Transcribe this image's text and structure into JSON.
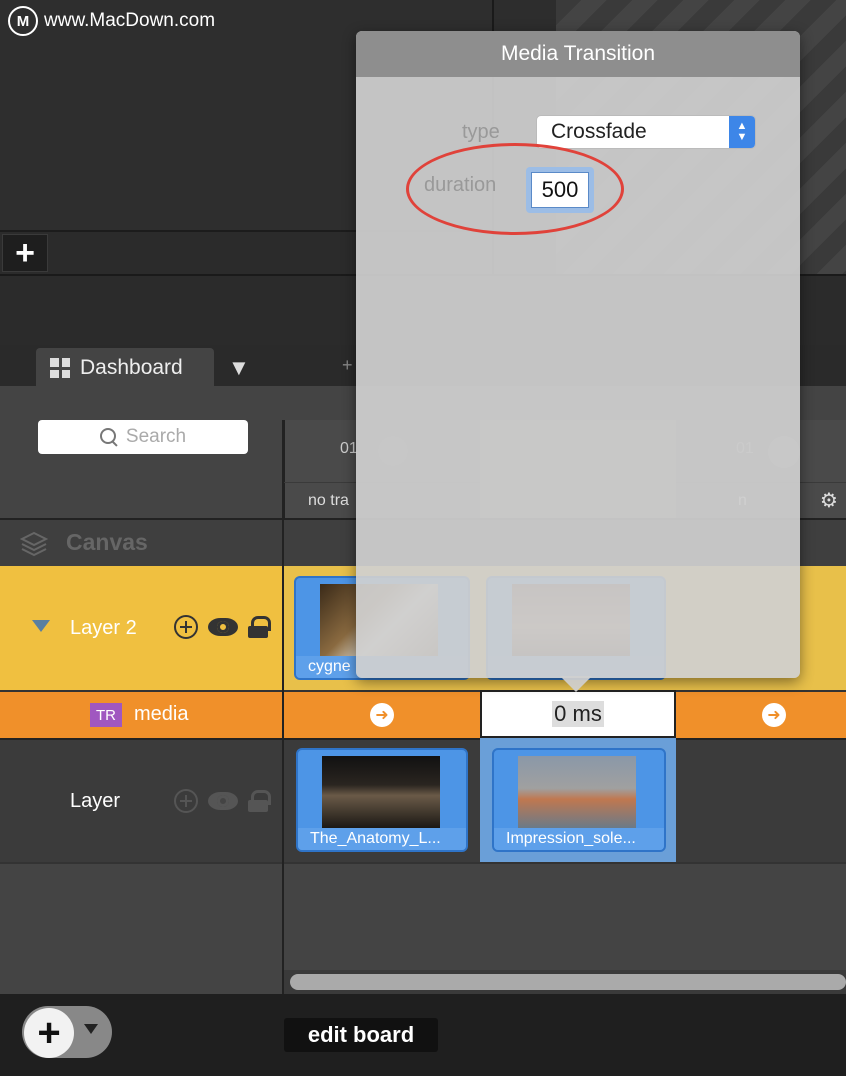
{
  "watermark": {
    "logo": "M",
    "text": "www.MacDown.com"
  },
  "top": {
    "add_output_symbol": "+"
  },
  "tabs": [
    {
      "label": "Dashboard",
      "icon": "grid-icon"
    }
  ],
  "tab_dropdown_symbol": "▼",
  "tab_add_symbol": "+",
  "search": {
    "placeholder": "Search"
  },
  "columns": [
    {
      "number": "01",
      "transition": "no tra"
    },
    {
      "number": "",
      "transition": ""
    },
    {
      "number": "01",
      "transition": "n"
    }
  ],
  "canvas": {
    "label": "Canvas",
    "icon": "layers-icon"
  },
  "layers": [
    {
      "name": "Layer 2",
      "expanded": true,
      "clips": [
        {
          "label": "cygne"
        },
        {
          "label": ""
        }
      ]
    },
    {
      "name": "Layer",
      "clips": [
        {
          "label": "The_Anatomy_L..."
        },
        {
          "label": "Impression_sole..."
        }
      ]
    }
  ],
  "media_row": {
    "badge": "TR",
    "label": "media",
    "transition_value": "0 ms",
    "go_symbol": "➜"
  },
  "gear_symbol": "⚙",
  "bottom_bar": {
    "add_layer_symbol": "+",
    "edit_board_label": "edit board"
  },
  "popover": {
    "title": "Media Transition",
    "type_label": "type",
    "type_value": "Crossfade",
    "duration_label": "duration",
    "duration_value": "500"
  },
  "colors": {
    "layer_active": "#f0c040",
    "media_row": "#f0902a",
    "clip_blue": "#4d95e6",
    "tr_badge": "#a057c0",
    "highlight_red": "#e0423a",
    "select_accent": "#3d86e8"
  }
}
